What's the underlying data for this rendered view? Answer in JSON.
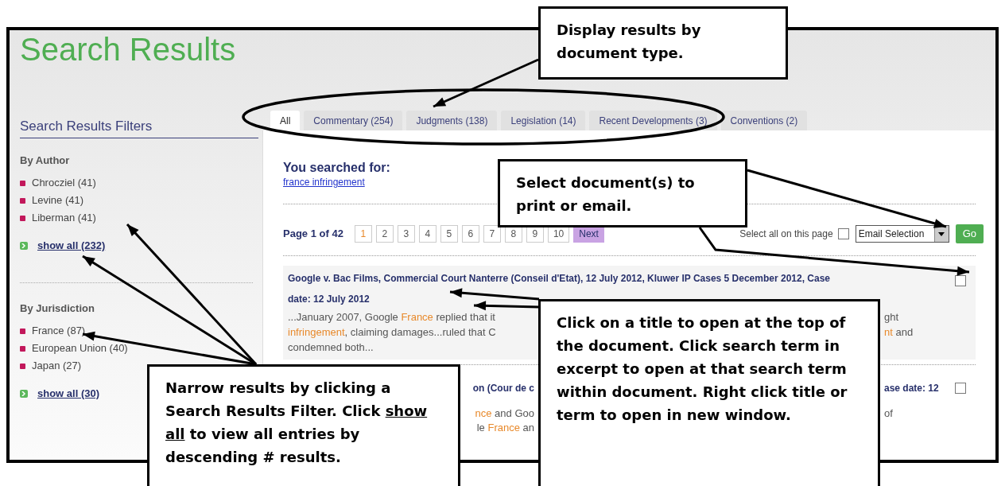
{
  "page_title": "Search Results",
  "filters": {
    "title": "Search Results Filters",
    "groups": [
      {
        "heading": "By Author",
        "items": [
          "Chrocziel (41)",
          "Levine (41)",
          "Liberman (41)"
        ],
        "show_all": "show all (232)"
      },
      {
        "heading": "By Jurisdiction",
        "items": [
          "France (87)",
          "European Union (40)",
          "Japan (27)"
        ],
        "show_all": "show all (30)"
      }
    ]
  },
  "tabs": [
    {
      "label": "All",
      "selected": true
    },
    {
      "label": "Commentary (254)",
      "selected": false
    },
    {
      "label": "Judgments (138)",
      "selected": false
    },
    {
      "label": "Legislation (14)",
      "selected": false
    },
    {
      "label": "Recent Developments (3)",
      "selected": false
    },
    {
      "label": "Conventions (2)",
      "selected": false
    }
  ],
  "query": {
    "label": "You searched for:",
    "link": "france infringement"
  },
  "pagination": {
    "label": "Page 1 of 42",
    "pages": [
      {
        "label": "1",
        "selected": true
      },
      {
        "label": "2",
        "selected": false
      },
      {
        "label": "3",
        "selected": false
      },
      {
        "label": "4",
        "selected": false
      },
      {
        "label": "5",
        "selected": false
      },
      {
        "label": "6",
        "selected": false
      },
      {
        "label": "7",
        "selected": false
      },
      {
        "label": "8",
        "selected": false
      },
      {
        "label": "9",
        "selected": false
      },
      {
        "label": "10",
        "selected": false
      }
    ],
    "next": "Next"
  },
  "selection": {
    "select_all_label": "Select all on this page",
    "select_all_checked": false,
    "action": "Email Selection",
    "go": "Go"
  },
  "results": [
    {
      "kind": "full",
      "title_lines": [
        "Google v. Bac Films, Commercial Court Nanterre (Conseil d'Etat), 12 July 2012, Kluwer IP Cases 5 December 2012, Case",
        "date: 12 July 2012"
      ],
      "checked": false,
      "lines": [
        {
          "left": [
            {
              "text": "...January 2007, Google ",
              "highlight": false
            },
            {
              "text": "France",
              "highlight": true
            },
            {
              "text": " replied that it",
              "highlight": false
            }
          ],
          "right": [
            {
              "text": "ght",
              "highlight": false
            }
          ]
        },
        {
          "left": [
            {
              "text": "infringement",
              "highlight": true
            },
            {
              "text": ", claiming damages...ruled that C",
              "highlight": false
            }
          ],
          "right": [
            {
              "text": "nt",
              "highlight": true
            },
            {
              "text": " and",
              "highlight": false
            }
          ]
        },
        {
          "left": [
            {
              "text": "condemned both...",
              "highlight": false
            }
          ]
        }
      ]
    },
    {
      "kind": "clipped",
      "title_left": "on (Cour de c",
      "title_right": "ase date: 12",
      "checked": false,
      "lines": [
        {
          "left": [
            {
              "text": "nce",
              "highlight": true
            },
            {
              "text": " and Goo",
              "highlight": false
            }
          ],
          "right": [
            {
              "text": "of",
              "highlight": false
            }
          ]
        },
        {
          "left": [
            {
              "text": "le ",
              "highlight": false
            },
            {
              "text": "France",
              "highlight": true
            },
            {
              "text": " an",
              "highlight": false
            }
          ]
        }
      ]
    }
  ],
  "callouts": [
    {
      "segments": [
        {
          "text": "Display results by document type.",
          "underline": false
        }
      ]
    },
    {
      "segments": [
        {
          "text": "Select document(s) to print or email.",
          "underline": false
        }
      ]
    },
    {
      "segments": [
        {
          "text": "Narrow results by clicking a Search Results Filter. Click ",
          "underline": false
        },
        {
          "text": "show all",
          "underline": true
        },
        {
          "text": " to view all entries by descending # results.",
          "underline": false
        }
      ]
    },
    {
      "segments": [
        {
          "text": "Click on a title to open at the top of the document.  Click search term in excerpt to open at that search term within document.  Right click title or term to open in new window.",
          "underline": false
        }
      ]
    }
  ]
}
